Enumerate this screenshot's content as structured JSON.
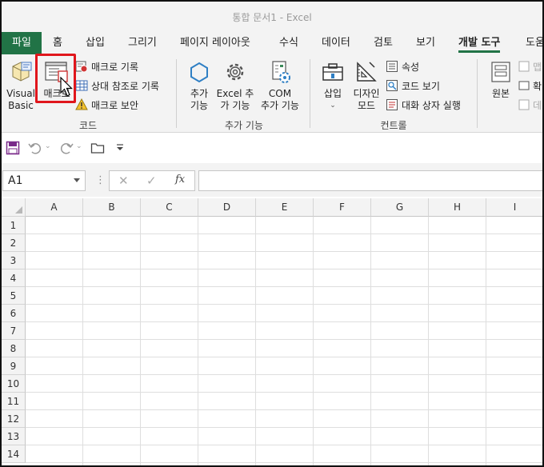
{
  "window": {
    "title": "통합 문서1  -  Excel"
  },
  "tabs": [
    {
      "label": "파일"
    },
    {
      "label": "홈"
    },
    {
      "label": "삽입"
    },
    {
      "label": "그리기"
    },
    {
      "label": "페이지 레이아웃"
    },
    {
      "label": "수식"
    },
    {
      "label": "데이터"
    },
    {
      "label": "검토"
    },
    {
      "label": "보기"
    },
    {
      "label": "개발 도구"
    },
    {
      "label": "도움"
    }
  ],
  "ribbon": {
    "code": {
      "label": "코드",
      "visual_basic": [
        "Visual",
        "Basic"
      ],
      "macro": "매크로",
      "record_macro": "매크로 기록",
      "relative_ref": "상대 참조로 기록",
      "macro_security": "매크로 보안"
    },
    "addins": {
      "label": "추가 기능",
      "addins_btn": [
        "추가",
        "기능"
      ],
      "excel_addins": [
        "Excel 추",
        "가 기능"
      ],
      "com_addins": [
        "COM",
        "추가 기능"
      ]
    },
    "controls": {
      "label": "컨트롤",
      "insert": "삽입",
      "design_mode": [
        "디자인",
        "모드"
      ],
      "properties": "속성",
      "view_code": "코드 보기",
      "run_dialog": "대화 상자 실행"
    },
    "xml": {
      "source": "원본",
      "partial_1": "맵",
      "partial_2": "확",
      "partial_3": "데"
    }
  },
  "formula_bar": {
    "name_box": "A1",
    "cancel": "✕",
    "enter": "✓",
    "fx": "fx"
  },
  "grid": {
    "columns": [
      "A",
      "B",
      "C",
      "D",
      "E",
      "F",
      "G",
      "H",
      "I"
    ],
    "rows": [
      "1",
      "2",
      "3",
      "4",
      "5",
      "6",
      "7",
      "8",
      "9",
      "10",
      "11",
      "12",
      "13",
      "14"
    ]
  },
  "colors": {
    "accent": "#217346",
    "highlight": "#e0161c"
  }
}
